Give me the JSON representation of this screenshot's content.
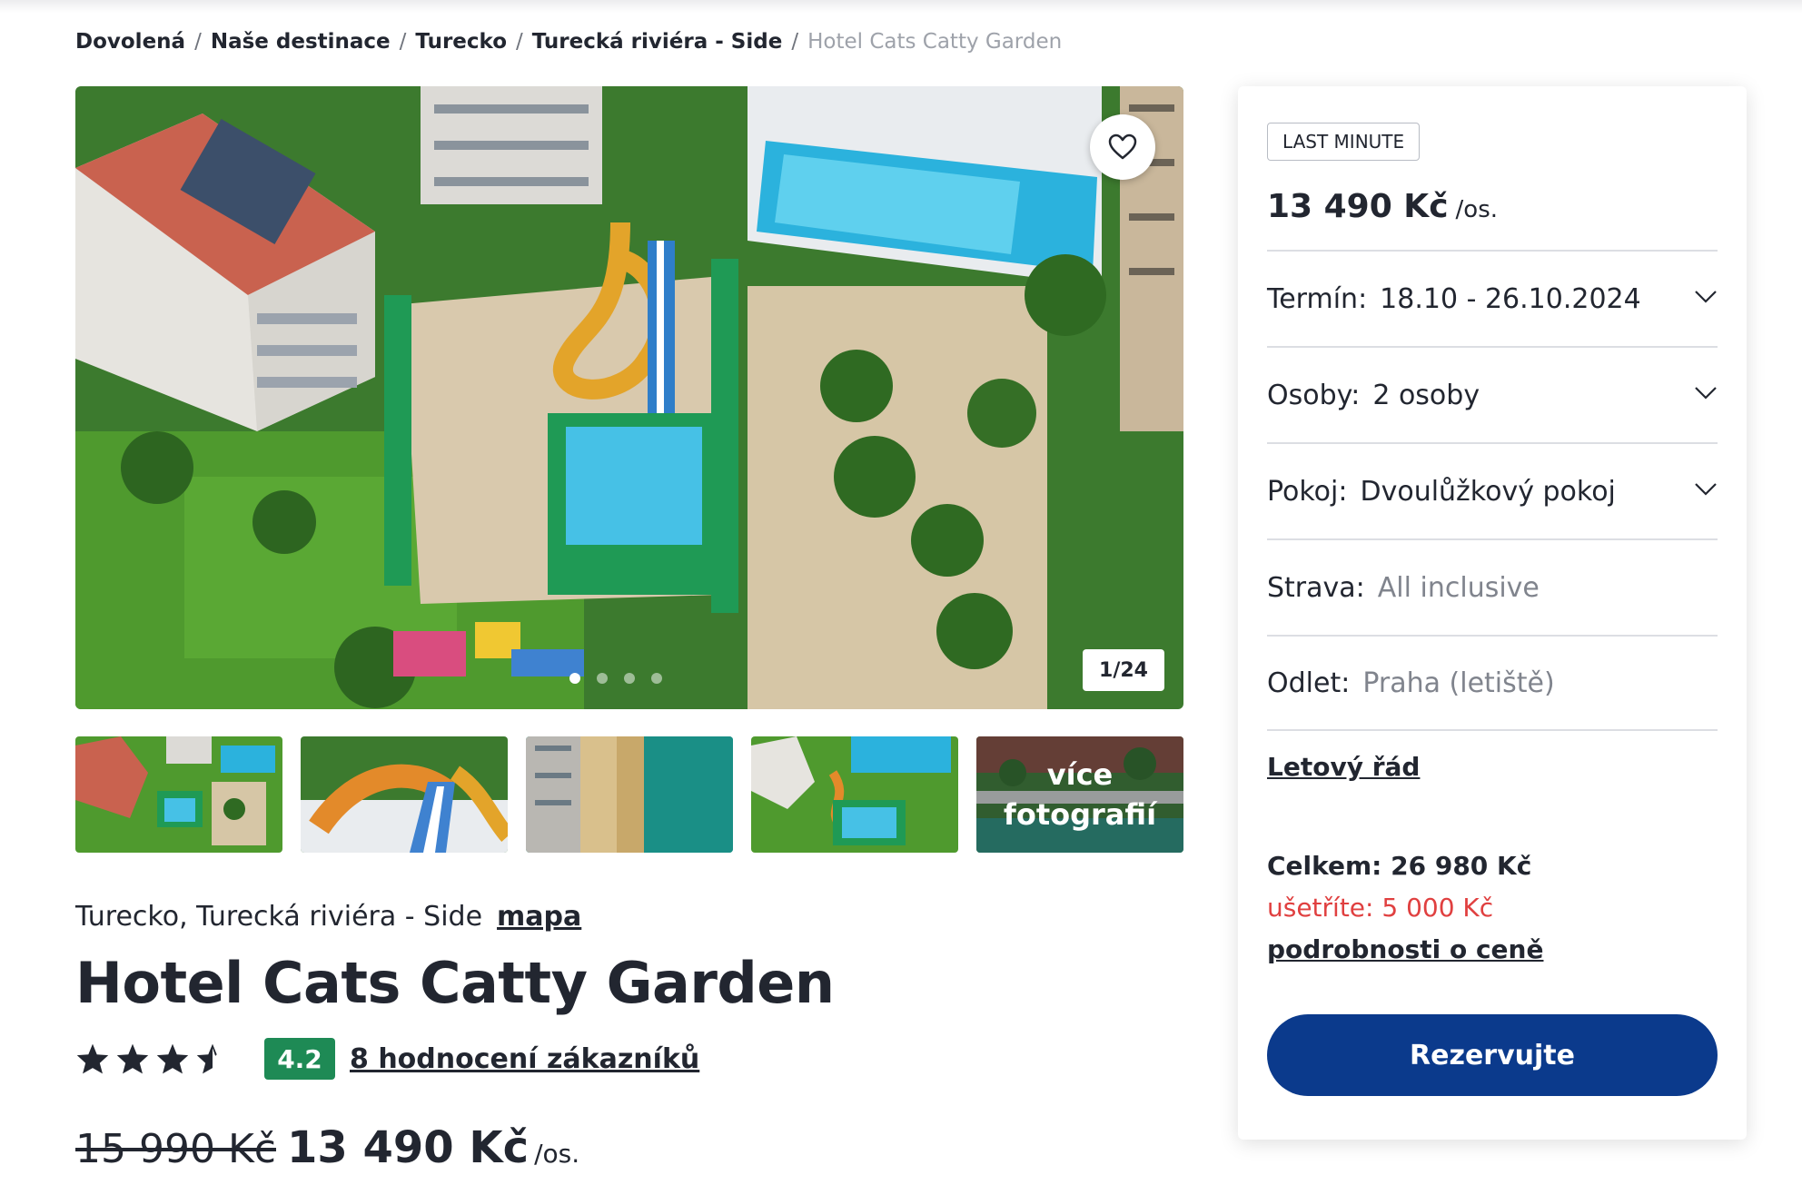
{
  "breadcrumb": [
    {
      "label": "Dovolená"
    },
    {
      "label": "Naše destinace"
    },
    {
      "label": "Turecko"
    },
    {
      "label": "Turecká riviéra - Side"
    },
    {
      "label": "Hotel Cats Catty Garden"
    }
  ],
  "gallery": {
    "counter": "1/24",
    "more_label": "více fotografií",
    "dots_count": 4,
    "active_dot": 0
  },
  "hotel": {
    "location": "Turecko, Turecká riviéra - Side",
    "map_link": "mapa",
    "name": "Hotel Cats Catty Garden",
    "stars": 3.5,
    "score": "4.2",
    "reviews_link": "8 hodnocení zákazníků",
    "old_price": "15 990 Kč",
    "price": "13 490 Kč",
    "per_person": "/os."
  },
  "booking": {
    "badge": "LAST MINUTE",
    "price": "13 490 Kč",
    "per_person": "/os.",
    "fields": {
      "term": {
        "label": "Termín:",
        "value": "18.10 - 26.10.2024"
      },
      "persons": {
        "label": "Osoby:",
        "value": "2 osoby"
      },
      "room": {
        "label": "Pokoj:",
        "value": "Dvoulůžkový pokoj"
      },
      "board": {
        "label": "Strava:",
        "value": "All inclusive"
      },
      "departure": {
        "label": "Odlet:",
        "value": "Praha (letiště)"
      }
    },
    "flight_link": "Letový řád",
    "total": "Celkem: 26 980 Kč",
    "savings": "ušetříte: 5 000 Kč",
    "details_link": "podrobnosti o ceně",
    "reserve_label": "Rezervujte"
  },
  "colors": {
    "accent": "#0b3a8c",
    "score_bg": "#1e8a55",
    "savings": "#e04040"
  }
}
